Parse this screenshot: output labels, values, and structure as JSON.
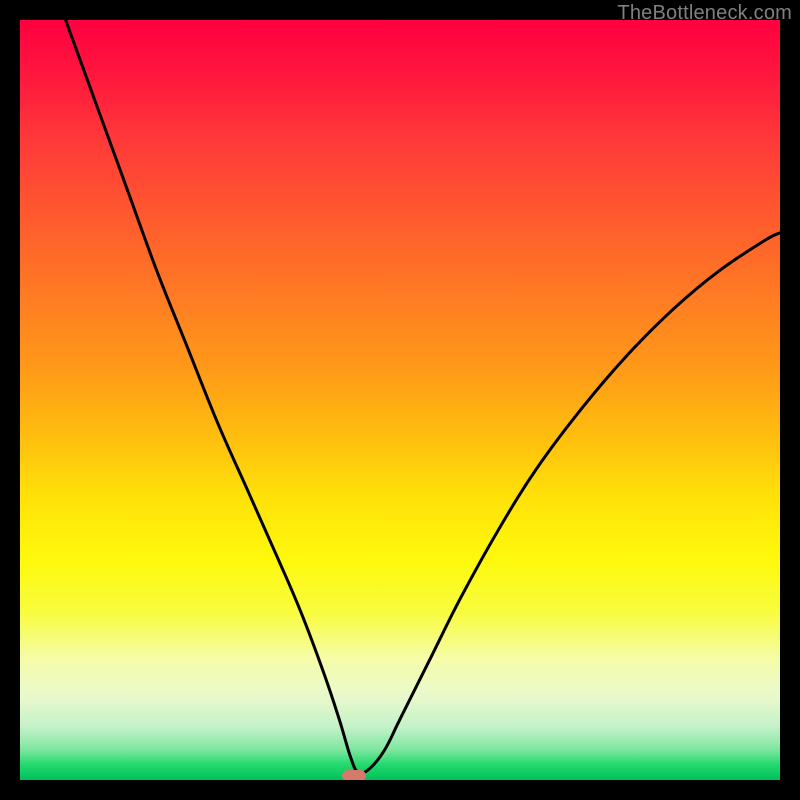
{
  "watermark": "TheBottleneck.com",
  "colors": {
    "frame_bg": "#000000",
    "curve": "#000000",
    "marker": "#d67a6a"
  },
  "chart_data": {
    "type": "line",
    "title": "",
    "xlabel": "",
    "ylabel": "",
    "xlim": [
      0,
      100
    ],
    "ylim": [
      0,
      100
    ],
    "grid": false,
    "legend": false,
    "marker": {
      "x": 44,
      "y": 0.5
    },
    "series": [
      {
        "name": "curve",
        "x": [
          6,
          10,
          14,
          18,
          22,
          26,
          30,
          34,
          37,
          40,
          42,
          43.5,
          44.5,
          46,
          48,
          50,
          54,
          58,
          63,
          68,
          74,
          80,
          86,
          92,
          98,
          100
        ],
        "y": [
          100,
          89,
          78,
          67,
          57,
          47,
          38,
          29,
          22,
          14,
          8,
          3,
          1,
          1.5,
          4,
          8,
          16,
          24,
          33,
          41,
          49,
          56,
          62,
          67,
          71,
          72
        ]
      }
    ]
  }
}
